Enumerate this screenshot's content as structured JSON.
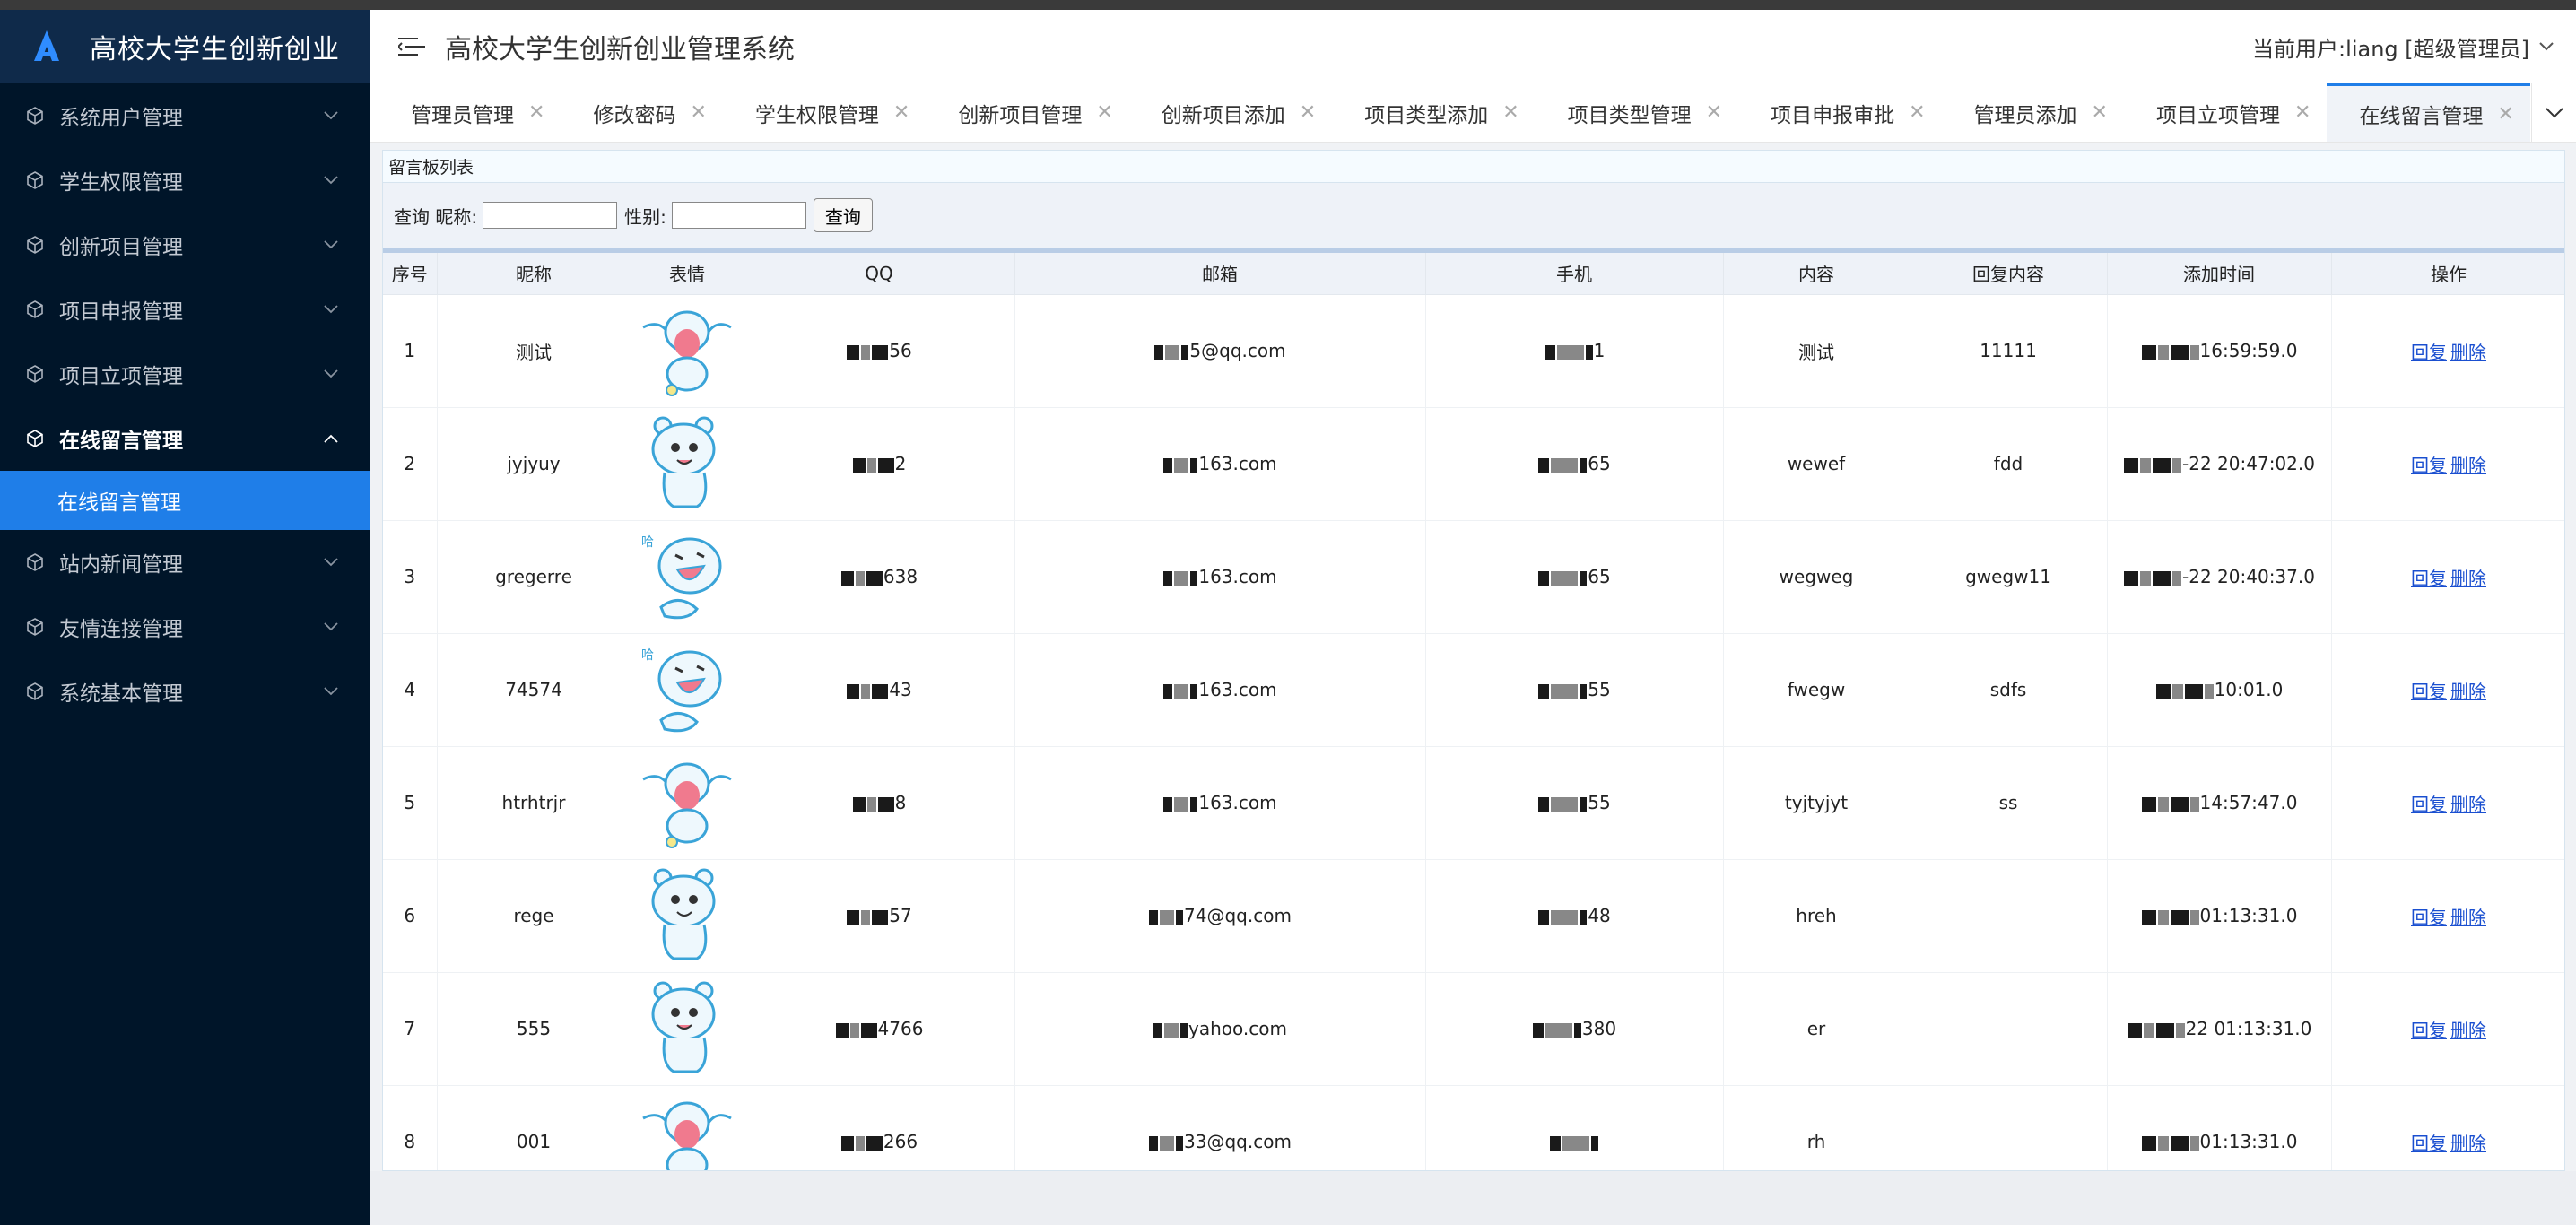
{
  "app": {
    "sidebar_title": "高校大学生创新创业",
    "system_title": "高校大学生创新创业管理系统",
    "current_user": "当前用户:liang [超级管理员]"
  },
  "sidebar": {
    "items": [
      {
        "label": "系统用户管理",
        "icon": "cube-icon",
        "open": false
      },
      {
        "label": "学生权限管理",
        "icon": "cube-icon",
        "open": false
      },
      {
        "label": "创新项目管理",
        "icon": "cube-icon",
        "open": false
      },
      {
        "label": "项目申报管理",
        "icon": "cube-icon",
        "open": false
      },
      {
        "label": "项目立项管理",
        "icon": "cube-icon",
        "open": false
      },
      {
        "label": "在线留言管理",
        "icon": "cube-icon",
        "open": true,
        "sub": "在线留言管理"
      },
      {
        "label": "站内新闻管理",
        "icon": "cube-icon",
        "open": false
      },
      {
        "label": "友情连接管理",
        "icon": "cube-icon",
        "open": false
      },
      {
        "label": "系统基本管理",
        "icon": "cube-icon",
        "open": false
      }
    ]
  },
  "tabs": [
    {
      "label": "管理员管理",
      "active": false
    },
    {
      "label": "修改密码",
      "active": false
    },
    {
      "label": "学生权限管理",
      "active": false
    },
    {
      "label": "创新项目管理",
      "active": false
    },
    {
      "label": "创新项目添加",
      "active": false
    },
    {
      "label": "项目类型添加",
      "active": false
    },
    {
      "label": "项目类型管理",
      "active": false
    },
    {
      "label": "项目申报审批",
      "active": false
    },
    {
      "label": "管理员添加",
      "active": false
    },
    {
      "label": "项目立项管理",
      "active": false
    },
    {
      "label": "在线留言管理",
      "active": true
    }
  ],
  "panel": {
    "title": "留言板列表",
    "search_prefix": "查询",
    "nickname_label": "昵称:",
    "gender_label": "性别:",
    "search_button": "查询"
  },
  "table": {
    "headers": [
      "序号",
      "昵称",
      "表情",
      "QQ",
      "邮箱",
      "手机",
      "内容",
      "回复内容",
      "添加时间",
      "操作"
    ],
    "reply_link": "回复",
    "delete_link": "删除",
    "rows": [
      {
        "no": "1",
        "nick": "测试",
        "face": "bear-crying",
        "qq": "56",
        "email": "5@qq.com",
        "phone": "1",
        "content": "测试",
        "reply": "11111",
        "time": "16:59:59.0"
      },
      {
        "no": "2",
        "nick": "jyjyuy",
        "face": "bear-tongue",
        "qq": "2",
        "email": "163.com",
        "phone": "65",
        "content": "wewef",
        "reply": "fdd",
        "time": "-22 20:47:02.0"
      },
      {
        "no": "3",
        "nick": "gregerre",
        "face": "bear-laugh",
        "qq": "638",
        "email": "163.com",
        "phone": "65",
        "content": "wegweg",
        "reply": "gwegw11",
        "time": "-22 20:40:37.0"
      },
      {
        "no": "4",
        "nick": "74574",
        "face": "bear-laugh",
        "qq": "43",
        "email": "163.com",
        "phone": "55",
        "content": "fwegw",
        "reply": "sdfs",
        "time": "10:01.0"
      },
      {
        "no": "5",
        "nick": "htrhtrjr",
        "face": "bear-crying",
        "qq": "8",
        "email": "163.com",
        "phone": "55",
        "content": "tyjtyjyt",
        "reply": "ss",
        "time": "14:57:47.0"
      },
      {
        "no": "6",
        "nick": "rege",
        "face": "bear-happy",
        "qq": "57",
        "email": "74@qq.com",
        "phone": "48",
        "content": "hreh",
        "reply": "",
        "time": "01:13:31.0"
      },
      {
        "no": "7",
        "nick": "555",
        "face": "bear-think",
        "qq": "4766",
        "email": "yahoo.com",
        "phone": "380",
        "content": "er",
        "reply": "",
        "time": "22 01:13:31.0"
      },
      {
        "no": "8",
        "nick": "001",
        "face": "bear-crying",
        "qq": "266",
        "email": "33@qq.com",
        "phone": "",
        "content": "rh",
        "reply": "",
        "time": "01:13:31.0"
      }
    ]
  },
  "colors": {
    "sidebar_bg": "#001529",
    "accent": "#1f7ee8",
    "link": "#1a4fd0"
  }
}
